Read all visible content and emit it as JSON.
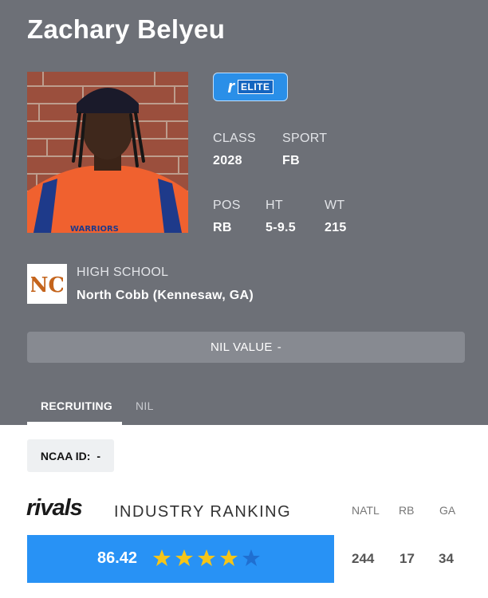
{
  "player": {
    "name": "Zachary Belyeu"
  },
  "badge": {
    "label": "ELITE",
    "icon": "rivals-r-icon"
  },
  "stats": {
    "class_label": "CLASS",
    "class_value": "2028",
    "sport_label": "SPORT",
    "sport_value": "FB",
    "pos_label": "POS",
    "pos_value": "RB",
    "ht_label": "HT",
    "ht_value": "5-9.5",
    "wt_label": "WT",
    "wt_value": "215"
  },
  "school": {
    "label": "HIGH SCHOOL",
    "name": "North Cobb (Kennesaw, GA)",
    "logo_text": "NC"
  },
  "nil": {
    "label": "NIL VALUE",
    "value": "-"
  },
  "tabs": [
    {
      "label": "RECRUITING",
      "active": true
    },
    {
      "label": "NIL",
      "active": false
    }
  ],
  "ncaa": {
    "label": "NCAA ID:",
    "value": "-"
  },
  "ranking": {
    "brand": "rivals",
    "title": "INDUSTRY RANKING",
    "rating": "86.42",
    "stars": 4,
    "max_stars": 5,
    "columns": [
      "NATL",
      "RB",
      "GA"
    ],
    "values": [
      "244",
      "17",
      "34"
    ]
  },
  "colors": {
    "hero_bg": "#6d7077",
    "accent_blue": "#2892f5",
    "star_gold": "#f5c518",
    "jersey_orange": "#f0612f"
  }
}
